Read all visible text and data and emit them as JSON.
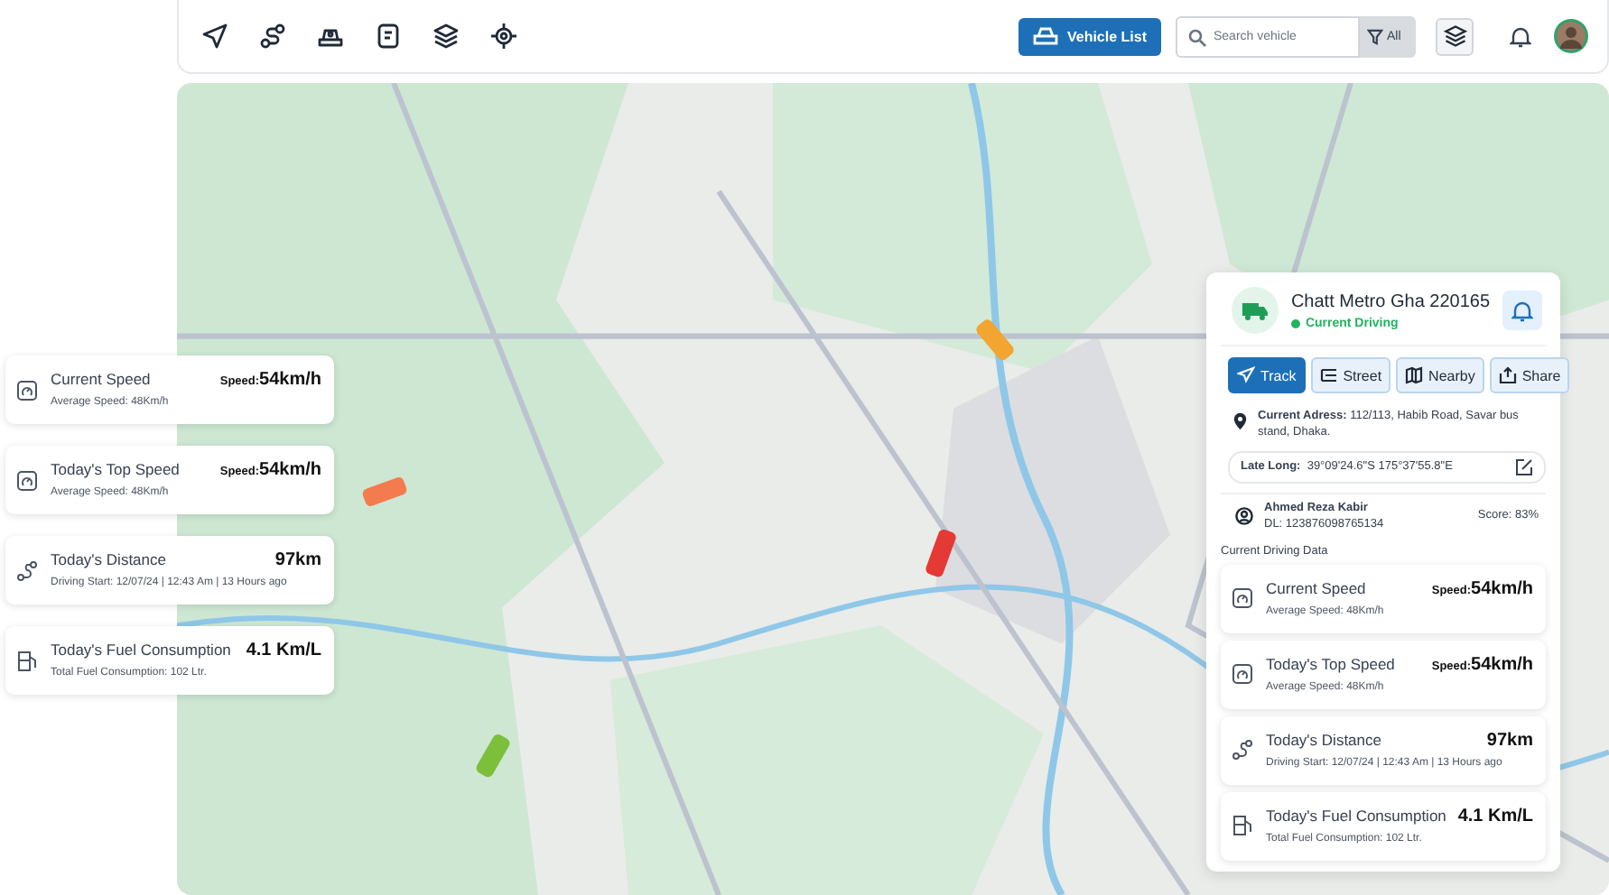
{
  "toolbar": {
    "nav_icons": [
      {
        "kind": "navigate"
      },
      {
        "kind": "route"
      },
      {
        "kind": "vehicle"
      },
      {
        "kind": "note"
      },
      {
        "kind": "layers"
      },
      {
        "kind": "target"
      }
    ],
    "vehicle_list_button": "Vehicle List",
    "search": {
      "placeholder": "Search vehicle"
    },
    "filter": "All"
  },
  "left_stats": [
    {
      "kind": "speed",
      "title": "Current Speed",
      "subtitle": "Average Speed: 48Km/h",
      "value_label": "Speed:",
      "value": "54km/h"
    },
    {
      "kind": "speed",
      "title": "Today's Top Speed",
      "subtitle": "Average Speed: 48Km/h",
      "value_label": "Speed:",
      "value": "54km/h"
    },
    {
      "kind": "distance",
      "title": "Today's Distance",
      "subtitle": "Driving Start: 12/07/24 | 12:43 Am | 13 Hours ago",
      "value": "97km"
    },
    {
      "kind": "fuel",
      "title": "Today's Fuel Consumption",
      "subtitle": "Total Fuel Consumption: 102 Ltr.",
      "value": "4.1 Km/L"
    }
  ],
  "panel": {
    "vehicle_name": "Chatt Metro Gha 220165",
    "status": "Current Driving",
    "actions": [
      {
        "label": "Track",
        "selected": true,
        "kind": "track"
      },
      {
        "label": "Street",
        "selected": false,
        "kind": "street"
      },
      {
        "label": "Nearby",
        "selected": false,
        "kind": "nearby"
      },
      {
        "label": "Share",
        "selected": false,
        "kind": "share"
      }
    ],
    "address_label": "Current Adress:",
    "address": "112/113, Habib Road, Savar bus stand, Dhaka.",
    "latlong_label": "Late Long:",
    "latlong": "39°09'24.6\"S 175°37'55.8\"E",
    "driver_name": "Ahmed Reza Kabir",
    "driver_license": "DL: 123876098765134",
    "score": "Score: 83%",
    "section_title": "Current Driving Data",
    "driving_data": [
      {
        "kind": "speed",
        "title": "Current Speed",
        "subtitle": "Average Speed: 48Km/h",
        "value_label": "Speed:",
        "value": "54km/h"
      },
      {
        "kind": "speed",
        "title": "Today's Top Speed",
        "subtitle": "Average Speed: 48Km/h",
        "value_label": "Speed:",
        "value": "54km/h"
      },
      {
        "kind": "distance",
        "title": "Today's Distance",
        "subtitle": "Driving Start: 12/07/24 | 12:43 Am | 13 Hours ago",
        "value": "97km"
      },
      {
        "kind": "fuel",
        "title": "Today's Fuel Consumption",
        "subtitle": "Total Fuel Consumption: 102 Ltr.",
        "value": "4.1 Km/L"
      }
    ]
  }
}
